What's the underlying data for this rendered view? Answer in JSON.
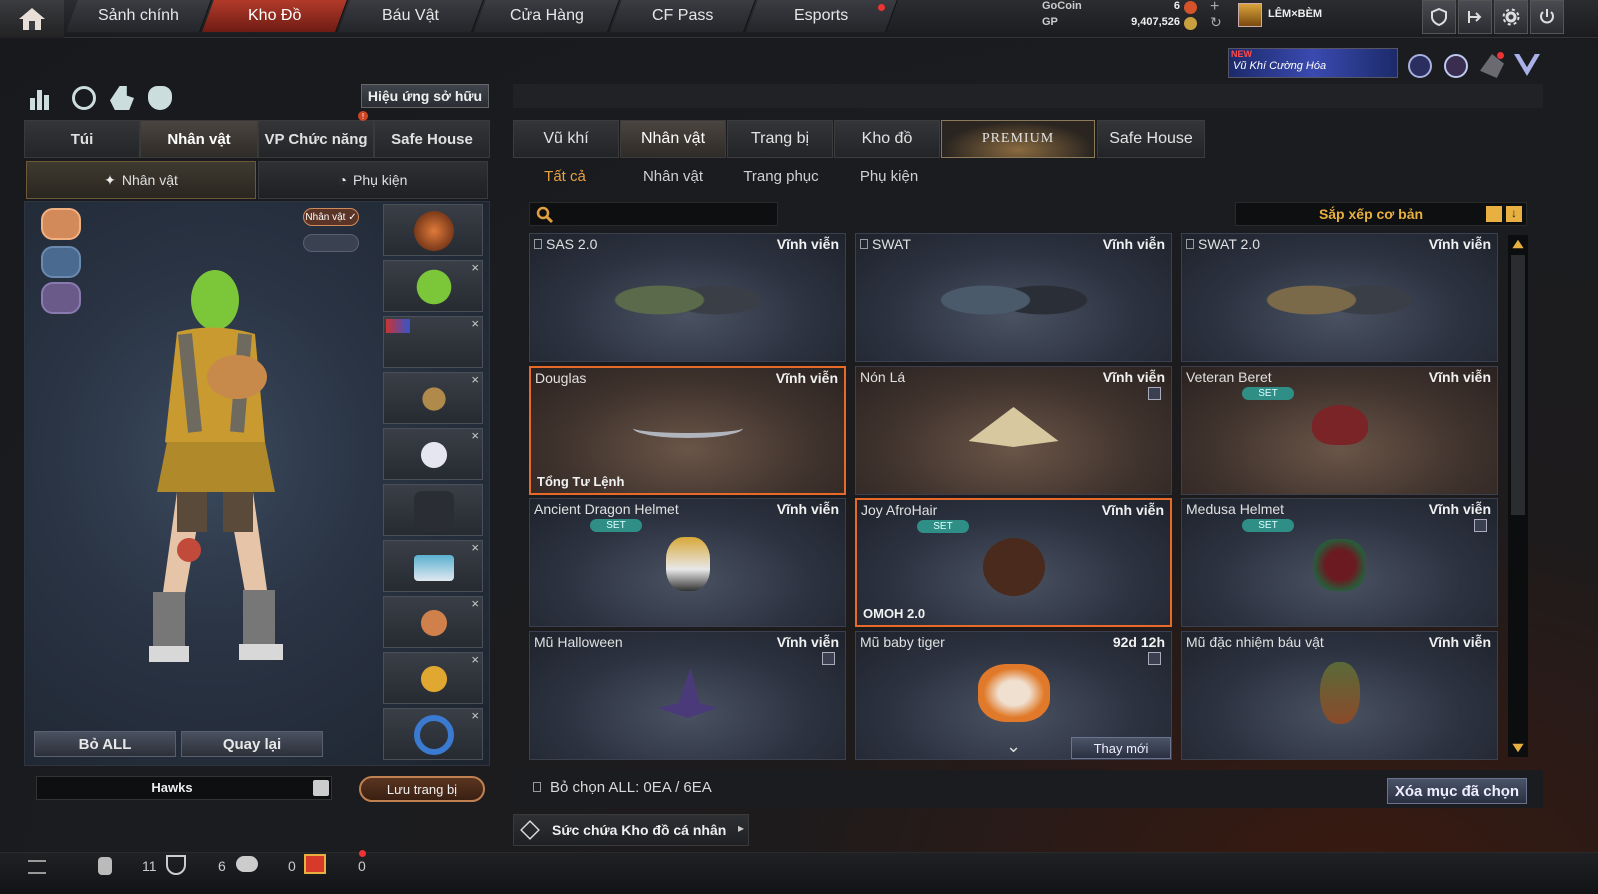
{
  "topnav": {
    "items": [
      "Sảnh chính",
      "Kho Đồ",
      "Báu Vật",
      "Cửa Hàng",
      "CF Pass",
      "Esports"
    ],
    "active": 1
  },
  "currency": {
    "gocoin_label": "GoCoin",
    "gocoin_value": "6",
    "gp_label": "GP",
    "gp_value": "9,407,526"
  },
  "user": {
    "name": "LÊM×BÈM"
  },
  "banner": {
    "new": "NEW",
    "text": "Vũ Khí Cường Hóa"
  },
  "left": {
    "effects_button": "Hiệu ứng sở hữu",
    "tabs": [
      "Túi",
      "Nhân vật",
      "VP Chức năng",
      "Safe House"
    ],
    "active_tab": 1,
    "subtabs": [
      "Nhân vật",
      "Phụ kiện"
    ],
    "char_badge": "Nhân vật ✓",
    "remove_all": "Bỏ ALL",
    "go_back": "Quay lại",
    "preset_name": "Hawks",
    "save_button": "Lưu trang bị"
  },
  "right": {
    "tabs": [
      "Vũ khí",
      "Nhân vật",
      "Trang bị",
      "Kho đồ",
      "PREMIUM",
      "Safe House"
    ],
    "active_tab": 1,
    "filters": [
      "Tất cả",
      "Nhân vật",
      "Trang phục",
      "Phụ kiện"
    ],
    "active_filter": 0,
    "search_placeholder": "",
    "sort_label": "Sắp xếp cơ bản",
    "items": [
      {
        "name": "SAS 2.0",
        "duration": "Vĩnh viễn",
        "pinned": true
      },
      {
        "name": "SWAT",
        "duration": "Vĩnh viễn",
        "pinned": true
      },
      {
        "name": "SWAT 2.0",
        "duration": "Vĩnh viễn",
        "pinned": true
      },
      {
        "name": "Douglas",
        "duration": "Vĩnh viễn",
        "tag": "Tổng Tư Lệnh",
        "selected": true
      },
      {
        "name": "Nón Lá",
        "duration": "Vĩnh viễn",
        "trash": true
      },
      {
        "name": "Veteran Beret",
        "duration": "Vĩnh viễn",
        "set": "SET"
      },
      {
        "name": "Ancient Dragon Helmet",
        "duration": "Vĩnh viễn",
        "set": "SET"
      },
      {
        "name": "Joy AfroHair",
        "duration": "Vĩnh viễn",
        "set": "SET",
        "tag": "OMOH 2.0",
        "selected": true
      },
      {
        "name": "Medusa Helmet",
        "duration": "Vĩnh viễn",
        "set": "SET",
        "trash": true
      },
      {
        "name": "Mũ Halloween",
        "duration": "Vĩnh viễn",
        "trash": true
      },
      {
        "name": "Mũ baby tiger",
        "duration": "92d 12h",
        "trash": true,
        "replace": "Thay mới"
      },
      {
        "name": "Mũ đặc nhiệm báu vật",
        "duration": "Vĩnh viễn"
      }
    ],
    "deselect_all": "Bỏ chọn ALL: 0EA / 6EA",
    "delete_selected": "Xóa mục đã chọn",
    "capacity": "Sức chứa Kho đồ cá nhân"
  },
  "bottombar": {
    "count1": "11",
    "count2": "6",
    "count3": "0",
    "count4": "0"
  }
}
